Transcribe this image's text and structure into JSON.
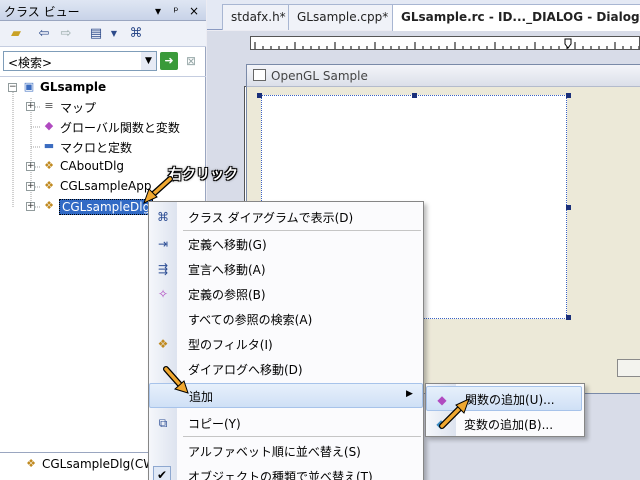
{
  "classview": {
    "title": "クラス ビュー",
    "title_buttons": [
      "▾",
      "ᵖ",
      "×"
    ],
    "search": {
      "value": "<検索>"
    },
    "tree": [
      {
        "label": "GLsample",
        "bold": true,
        "icon": "project-icon"
      },
      {
        "label": "マップ",
        "icon": "map-icon"
      },
      {
        "label": "グローバル関数と変数",
        "icon": "global-icon"
      },
      {
        "label": "マクロと定数",
        "icon": "macro-icon"
      },
      {
        "label": "CAboutDlg",
        "icon": "class-icon"
      },
      {
        "label": "CGLsampleApp",
        "icon": "class-icon"
      },
      {
        "label": "CGLsampleDlg",
        "icon": "class-icon",
        "selected": true
      }
    ],
    "lower_item": "CGLsampleDlg(CW"
  },
  "editor": {
    "tabs": [
      {
        "label": "stdafx.h*"
      },
      {
        "label": "GLsample.cpp*"
      },
      {
        "label": "GLsample.rc - ID..._DIALOG - Dialog*",
        "active": true
      }
    ],
    "dialog_title": "OpenGL Sample"
  },
  "annotation": "右クリック",
  "context_menu": [
    {
      "label": "クラス ダイアグラムで表示(D)",
      "icon": "class-diagram-icon"
    },
    {
      "separator": true
    },
    {
      "label": "定義へ移動(G)",
      "icon": "goto-definition-icon"
    },
    {
      "label": "宣言へ移動(A)",
      "icon": "goto-declaration-icon"
    },
    {
      "label": "定義の参照(B)",
      "icon": "browse-definition-icon"
    },
    {
      "label": "すべての参照の検索(A)",
      "icon": ""
    },
    {
      "label": "型のフィルタ(I)",
      "icon": "type-filter-icon"
    },
    {
      "label": "ダイアログへ移動(D)",
      "icon": ""
    },
    {
      "label": "追加",
      "icon": "",
      "submenu": true,
      "highlighted": true
    },
    {
      "label": "コピー(Y)",
      "icon": "copy-icon"
    },
    {
      "separator": true
    },
    {
      "label": "アルファベット順に並べ替え(S)",
      "icon": ""
    },
    {
      "label": "オブジェクトの種類で並べ替え(T)",
      "icon": "check-icon",
      "checked": true
    }
  ],
  "submenu": [
    {
      "label": "関数の追加(U)...",
      "icon": "add-function-icon",
      "highlighted": true
    },
    {
      "label": "変数の追加(B)...",
      "icon": "add-variable-icon"
    }
  ],
  "colors": {
    "selection": "#316ac5",
    "annotation_arrow": "#f0a830",
    "menu_highlight": "#cfe0f6"
  }
}
